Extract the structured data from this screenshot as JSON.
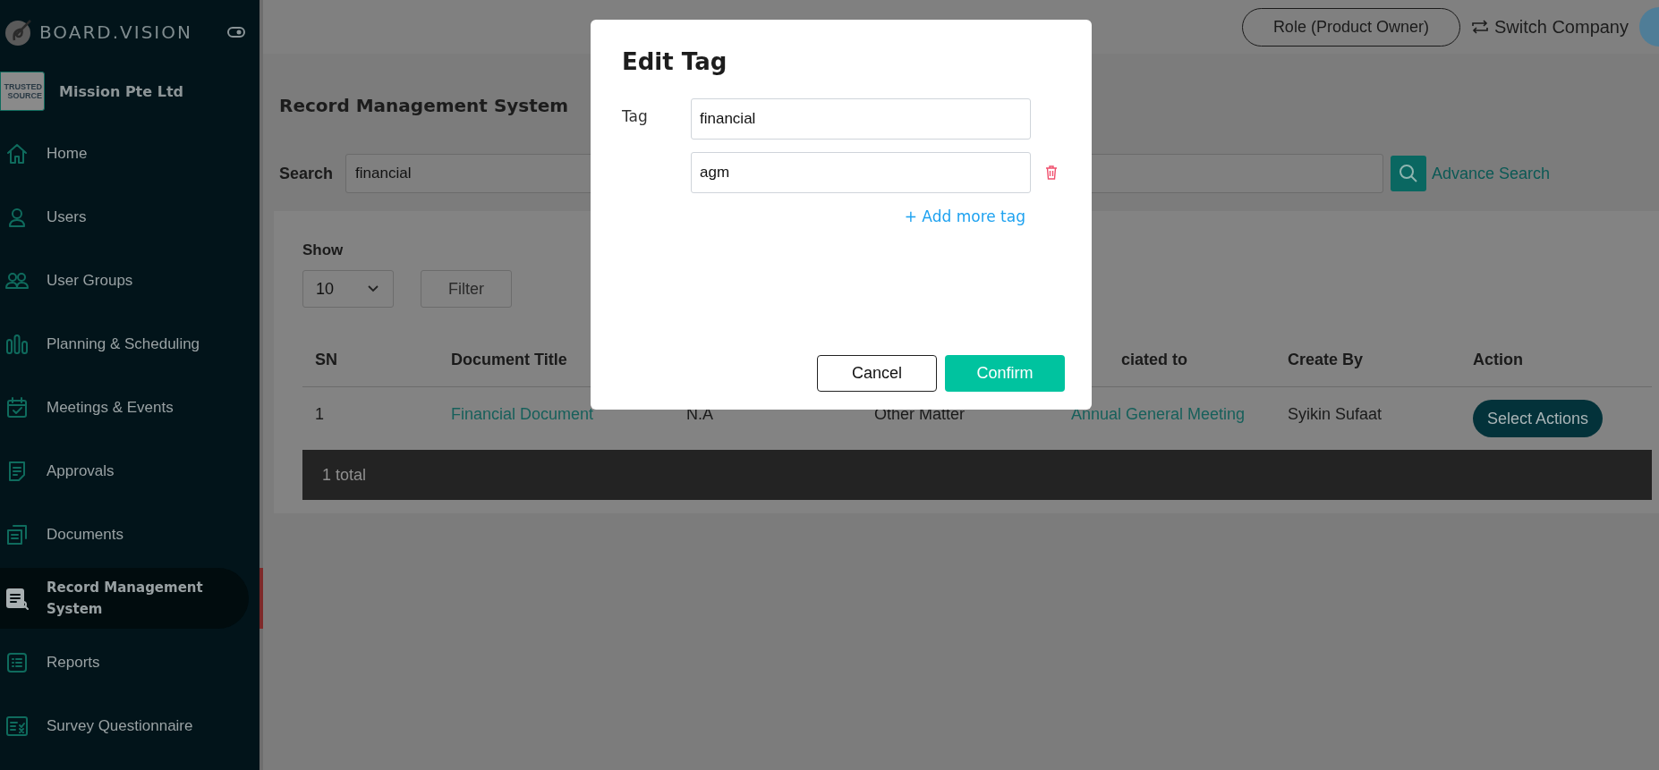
{
  "brand": {
    "name": "BOARD.VISION",
    "company": "Mission Pte Ltd",
    "company_logo": [
      "TRUSTED",
      "SOURCE"
    ]
  },
  "sidebar": {
    "items": [
      {
        "label": "Home",
        "selected": false
      },
      {
        "label": "Users",
        "selected": false
      },
      {
        "label": "User Groups",
        "selected": false
      },
      {
        "label": "Planning & Scheduling",
        "selected": false
      },
      {
        "label": "Meetings & Events",
        "selected": false
      },
      {
        "label": "Approvals",
        "selected": false
      },
      {
        "label": "Documents",
        "selected": false
      },
      {
        "label": "Record Management System",
        "selected": true
      },
      {
        "label": "Reports",
        "selected": false
      },
      {
        "label": "Survey Questionnaire",
        "selected": false
      }
    ]
  },
  "header": {
    "role": "Role (Product Owner)",
    "switch": "Switch Company"
  },
  "page": {
    "title": "Record Management System",
    "search_label": "Search",
    "search_value": "financial",
    "advance": "Advance Search"
  },
  "show": {
    "label": "Show",
    "value": "10",
    "filter": "Filter"
  },
  "table": {
    "columns": [
      "SN",
      "Document Title",
      "",
      "",
      "ciated to",
      "Create By",
      "Action"
    ],
    "rows": [
      {
        "cells": [
          "1",
          "Financial Document",
          "N.A",
          "Other Matter",
          "Annual General Meeting",
          "Syikin Sufaat"
        ],
        "action": "Select Actions"
      }
    ],
    "footer": "1 total"
  },
  "dialog": {
    "title": "Edit Tag",
    "label": "Tag",
    "tags": [
      {
        "value": "financial",
        "removable": false
      },
      {
        "value": "agm",
        "removable": true
      }
    ],
    "add": "+ Add more tag",
    "cancel": "Cancel",
    "confirm": "Confirm"
  }
}
